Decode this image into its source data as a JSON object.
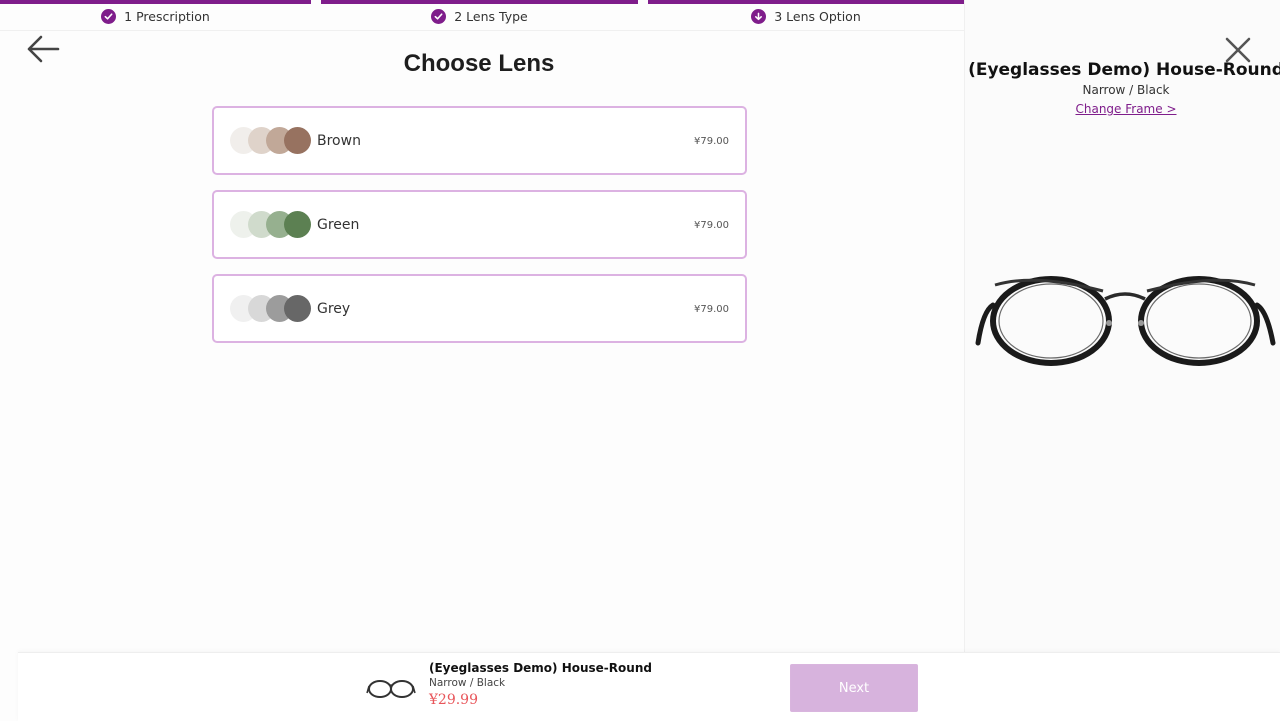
{
  "steps": [
    {
      "label": "1 Prescription",
      "icon": "check-icon"
    },
    {
      "label": "2 Lens Type",
      "icon": "check-icon"
    },
    {
      "label": "3 Lens Option",
      "icon": "arrow-down-icon"
    }
  ],
  "page_title": "Choose Lens",
  "options": [
    {
      "name": "Brown",
      "price": "¥79.00",
      "swatches": [
        "#f1eeeb",
        "#dfd3ca",
        "#c1a898",
        "#977260"
      ]
    },
    {
      "name": "Green",
      "price": "¥79.00",
      "swatches": [
        "#eef1ec",
        "#d0dbcc",
        "#96b08f",
        "#5c8052"
      ]
    },
    {
      "name": "Grey",
      "price": "¥79.00",
      "swatches": [
        "#f0f0f0",
        "#d8d8d8",
        "#9c9c9c",
        "#676767"
      ]
    }
  ],
  "product": {
    "title": "(Eyeglasses Demo) House-Round",
    "subtitle": "Narrow / Black",
    "change_frame": "Change Frame >"
  },
  "bottom_bar": {
    "name": "(Eyeglasses Demo) House-Round",
    "subtitle": "Narrow / Black",
    "price": "¥29.99",
    "next_label": "Next"
  },
  "colors": {
    "accent": "#7f1d8b",
    "option_border": "#dcb2e2",
    "next_disabled": "#d7b3dd",
    "price": "#e8555a"
  }
}
